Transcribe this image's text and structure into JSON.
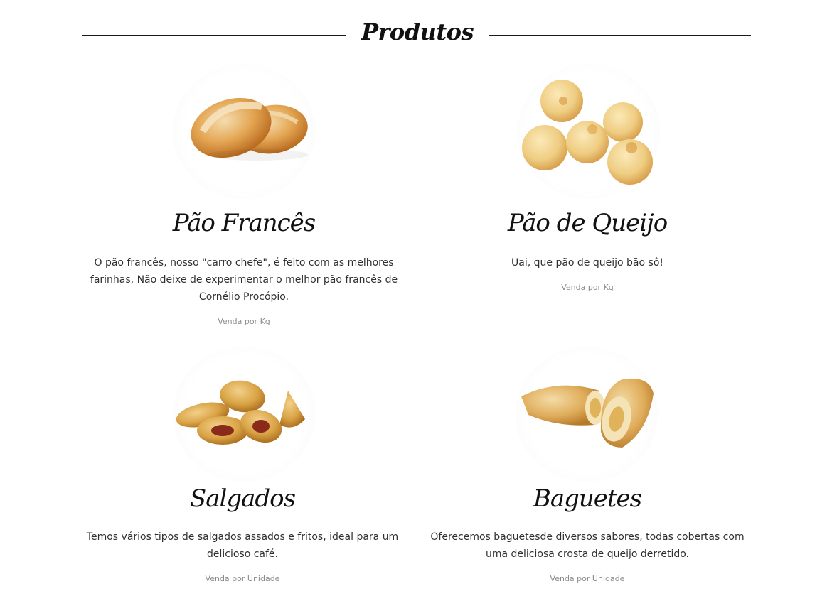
{
  "section": {
    "title": "Produtos"
  },
  "products": [
    {
      "name": "Pão Francês",
      "description": "O pão francês, nosso \"carro chefe\", é feito com as melhores farinhas, Não deixe de experimentar o melhor pão francês de Cornélio Procópio.",
      "unit": "Venda por Kg",
      "image_icon": "french-bread-image"
    },
    {
      "name": "Pão de Queijo",
      "description": "Uai, que pão de queijo bão sô!",
      "unit": "Venda por Kg",
      "image_icon": "cheese-bread-image"
    },
    {
      "name": "Salgados",
      "description": "Temos vários tipos de salgados assados e fritos, ideal para um delicioso café.",
      "unit": "Venda por Unidade",
      "image_icon": "savory-snacks-image"
    },
    {
      "name": "Baguetes",
      "description": "Oferecemos baguetesde diversos sabores, todas cobertas com uma deliciosa crosta de queijo derretido.",
      "unit": "Venda por Unidade",
      "image_icon": "baguette-image"
    }
  ],
  "colors": {
    "text": "#2f2f2f",
    "title": "#111111",
    "muted": "#8a8a8a",
    "bread": "#d99a45"
  }
}
